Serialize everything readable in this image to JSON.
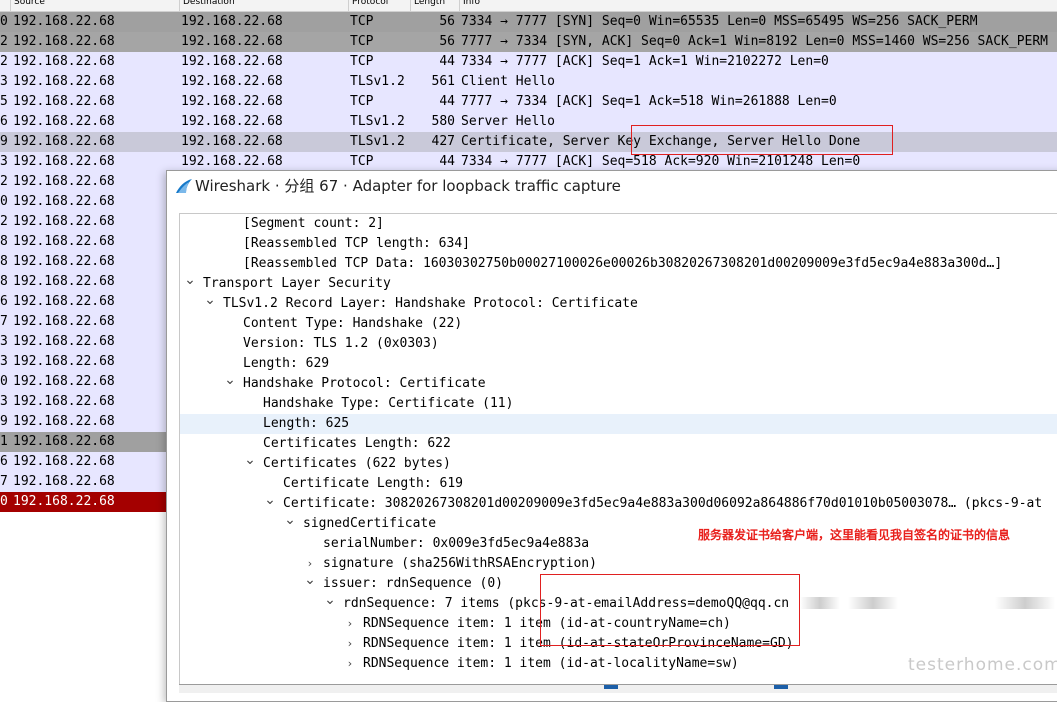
{
  "packet_list": {
    "headers": {
      "source": "Source",
      "destination": "Destination",
      "protocol": "Protocol",
      "length": "Length",
      "info": "Info"
    },
    "rows": [
      {
        "no_tail": "0",
        "src": "192.168.22.68",
        "dst": "192.168.22.68",
        "proto": "TCP",
        "len": "56",
        "info": "7334 → 7777 [SYN] Seq=0 Win=65535 Len=0 MSS=65495 WS=256 SACK_PERM",
        "style": "gray"
      },
      {
        "no_tail": "2",
        "src": "192.168.22.68",
        "dst": "192.168.22.68",
        "proto": "TCP",
        "len": "56",
        "info": "7777 → 7334 [SYN, ACK] Seq=0 Ack=1 Win=8192 Len=0 MSS=1460 WS=256 SACK_PERM",
        "style": "gray2"
      },
      {
        "no_tail": "2",
        "src": "192.168.22.68",
        "dst": "192.168.22.68",
        "proto": "TCP",
        "len": "44",
        "info": "7334 → 7777 [ACK] Seq=1 Ack=1 Win=2102272 Len=0",
        "style": "lav"
      },
      {
        "no_tail": "3",
        "src": "192.168.22.68",
        "dst": "192.168.22.68",
        "proto": "TLSv1.2",
        "len": "561",
        "info": "Client Hello",
        "style": "lav"
      },
      {
        "no_tail": "5",
        "src": "192.168.22.68",
        "dst": "192.168.22.68",
        "proto": "TCP",
        "len": "44",
        "info": "7777 → 7334 [ACK] Seq=1 Ack=518 Win=261888 Len=0",
        "style": "lav"
      },
      {
        "no_tail": "6",
        "src": "192.168.22.68",
        "dst": "192.168.22.68",
        "proto": "TLSv1.2",
        "len": "580",
        "info": "Server Hello",
        "style": "lav"
      },
      {
        "no_tail": "9",
        "src": "192.168.22.68",
        "dst": "192.168.22.68",
        "proto": "TLSv1.2",
        "len": "427",
        "info": "Certificate, Server Key Exchange, Server Hello Done",
        "style": "sel"
      },
      {
        "no_tail": "3",
        "src": "192.168.22.68",
        "dst": "192.168.22.68",
        "proto": "TCP",
        "len": "44",
        "info": "7334 → 7777 [ACK] Seq=518 Ack=920 Win=2101248 Len=0",
        "style": "lav"
      },
      {
        "no_tail": "2",
        "src": "192.168.22.68",
        "style": "lav"
      },
      {
        "no_tail": "0",
        "src": "192.168.22.68",
        "style": "lav"
      },
      {
        "no_tail": "2",
        "src": "192.168.22.68",
        "style": "lav"
      },
      {
        "no_tail": "8",
        "src": "192.168.22.68",
        "style": "lav"
      },
      {
        "no_tail": "8",
        "src": "192.168.22.68",
        "style": "lav"
      },
      {
        "no_tail": "8",
        "src": "192.168.22.68",
        "style": "lav"
      },
      {
        "no_tail": "6",
        "src": "192.168.22.68",
        "style": "lav"
      },
      {
        "no_tail": "7",
        "src": "192.168.22.68",
        "style": "lav"
      },
      {
        "no_tail": "3",
        "src": "192.168.22.68",
        "style": "lav"
      },
      {
        "no_tail": "3",
        "src": "192.168.22.68",
        "style": "lav"
      },
      {
        "no_tail": "0",
        "src": "192.168.22.68",
        "style": "lav"
      },
      {
        "no_tail": "3",
        "src": "192.168.22.68",
        "style": "lav"
      },
      {
        "no_tail": "9",
        "src": "192.168.22.68",
        "style": "lav"
      },
      {
        "no_tail": "1",
        "src": "192.168.22.68",
        "style": "gray"
      },
      {
        "no_tail": "6",
        "src": "192.168.22.68",
        "style": "lav"
      },
      {
        "no_tail": "7",
        "src": "192.168.22.68",
        "style": "lav"
      },
      {
        "no_tail": "0",
        "src": "192.168.22.68",
        "style": "red"
      }
    ]
  },
  "detail_window": {
    "title": "Wireshark · 分组 67 · Adapter for loopback traffic capture",
    "tree": [
      {
        "indent": 2,
        "arrow": "",
        "text": "[Segment count: 2]"
      },
      {
        "indent": 2,
        "arrow": "",
        "text": "[Reassembled TCP length: 634]"
      },
      {
        "indent": 2,
        "arrow": "",
        "text": "[Reassembled TCP Data: 16030302750b00027100026e00026b30820267308201d00209009e3fd5ec9a4e883a300d…]"
      },
      {
        "indent": 0,
        "arrow": "down",
        "text": "Transport Layer Security"
      },
      {
        "indent": 1,
        "arrow": "down",
        "text": "TLSv1.2 Record Layer: Handshake Protocol: Certificate"
      },
      {
        "indent": 2,
        "arrow": "",
        "text": "Content Type: Handshake (22)"
      },
      {
        "indent": 2,
        "arrow": "",
        "text": "Version: TLS 1.2 (0x0303)"
      },
      {
        "indent": 2,
        "arrow": "",
        "text": "Length: 629"
      },
      {
        "indent": 2,
        "arrow": "down",
        "text": "Handshake Protocol: Certificate"
      },
      {
        "indent": 3,
        "arrow": "",
        "text": "Handshake Type: Certificate (11)"
      },
      {
        "indent": 3,
        "arrow": "",
        "text": "Length: 625",
        "selected": true
      },
      {
        "indent": 3,
        "arrow": "",
        "text": "Certificates Length: 622"
      },
      {
        "indent": 3,
        "arrow": "down",
        "text": "Certificates (622 bytes)"
      },
      {
        "indent": 4,
        "arrow": "",
        "text": "Certificate Length: 619"
      },
      {
        "indent": 4,
        "arrow": "down",
        "text": "Certificate: 30820267308201d00209009e3fd5ec9a4e883a300d06092a864886f70d01010b05003078… (pkcs-9-at"
      },
      {
        "indent": 5,
        "arrow": "down",
        "text": "signedCertificate"
      },
      {
        "indent": 6,
        "arrow": "",
        "text": "serialNumber: 0x009e3fd5ec9a4e883a"
      },
      {
        "indent": 6,
        "arrow": "right",
        "text": "signature (sha256WithRSAEncryption)"
      },
      {
        "indent": 6,
        "arrow": "down",
        "text": "issuer: rdnSequence (0)"
      },
      {
        "indent": 7,
        "arrow": "down",
        "text": "rdnSequence: 7 items (pkcs-9-at-emailAddress=demoQQ@qq.cn"
      },
      {
        "indent": 8,
        "arrow": "right",
        "text": "RDNSequence item: 1 item (id-at-countryName=ch)"
      },
      {
        "indent": 8,
        "arrow": "right",
        "text": "RDNSequence item: 1 item (id-at-stateOrProvinceName=GD)"
      },
      {
        "indent": 8,
        "arrow": "right",
        "text": "RDNSequence item: 1 item (id-at-localityName=sw)"
      }
    ]
  },
  "annotation": {
    "text": "服务器发证书给客户端，这里能看见我自签名的证书的信息",
    "color": "#e8201c"
  },
  "watermark": {
    "text": "testerhome.com"
  },
  "colors": {
    "row_gray": "#a0a0a0",
    "row_lavender": "#e7e6ff",
    "row_selected": "#c9c9d9",
    "row_red": "#a40000",
    "highlight_box": "#e02020"
  }
}
